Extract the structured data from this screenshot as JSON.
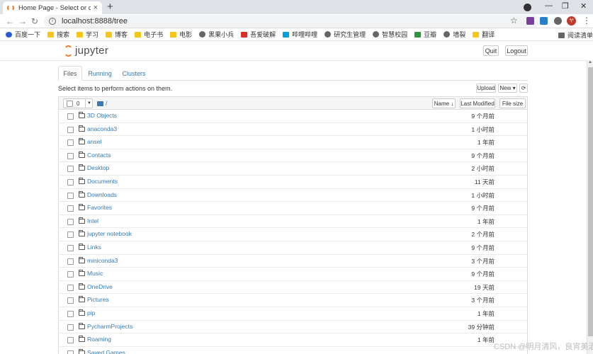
{
  "browser": {
    "tab_title": "Home Page - Select or create",
    "tab_close": "×",
    "new_tab": "+",
    "url": "localhost:8888/tree",
    "avatar_letter": "ヤ",
    "bookmarks": [
      {
        "label": "百度一下",
        "icon": "paw-icon"
      },
      {
        "label": "搜索",
        "icon": "folder-icon"
      },
      {
        "label": "学习",
        "icon": "folder-icon"
      },
      {
        "label": "博客",
        "icon": "folder-icon"
      },
      {
        "label": "电子书",
        "icon": "folder-icon"
      },
      {
        "label": "电影",
        "icon": "folder-icon"
      },
      {
        "label": "黑果小兵",
        "icon": "globe-icon"
      },
      {
        "label": "吾爱破解",
        "icon": "red-icon"
      },
      {
        "label": "哔哩哔哩",
        "icon": "tv-icon"
      },
      {
        "label": "研究生管理",
        "icon": "globe-icon"
      },
      {
        "label": "智慧校园",
        "icon": "globe-icon"
      },
      {
        "label": "豆瓣",
        "icon": "green-icon"
      },
      {
        "label": "墙裂",
        "icon": "globe-icon"
      },
      {
        "label": "翻译",
        "icon": "folder-icon"
      }
    ],
    "reading_list": "阅读清单"
  },
  "jupyter": {
    "logo_text": "jupyter",
    "quit_label": "Quit",
    "logout_label": "Logout",
    "tabs": [
      {
        "label": "Files",
        "active": true
      },
      {
        "label": "Running",
        "active": false
      },
      {
        "label": "Clusters",
        "active": false
      }
    ],
    "hint": "Select items to perform actions on them.",
    "upload_label": "Upload",
    "new_label": "New ▾",
    "refresh_label": "⟳",
    "selected_count": "0",
    "breadcrumb": "/",
    "name_sort_label": "Name ↓",
    "last_modified_label": "Last Modified",
    "file_size_label": "File size",
    "files": [
      {
        "name": "3D Objects",
        "modified": "9 个月前"
      },
      {
        "name": "anaconda3",
        "modified": "1 小时前"
      },
      {
        "name": "ansel",
        "modified": "1 年前"
      },
      {
        "name": "Contacts",
        "modified": "9 个月前"
      },
      {
        "name": "Desktop",
        "modified": "2 小时前"
      },
      {
        "name": "Documents",
        "modified": "11 天前"
      },
      {
        "name": "Downloads",
        "modified": "1 小时前"
      },
      {
        "name": "Favorites",
        "modified": "9 个月前"
      },
      {
        "name": "Intel",
        "modified": "1 年前"
      },
      {
        "name": "jupyter notebook",
        "modified": "2 个月前"
      },
      {
        "name": "Links",
        "modified": "9 个月前"
      },
      {
        "name": "miniconda3",
        "modified": "3 个月前"
      },
      {
        "name": "Music",
        "modified": "9 个月前"
      },
      {
        "name": "OneDrive",
        "modified": "19 天前"
      },
      {
        "name": "Pictures",
        "modified": "3 个月前"
      },
      {
        "name": "pip",
        "modified": "1 年前"
      },
      {
        "name": "PycharmProjects",
        "modified": "39 分钟前"
      },
      {
        "name": "Roaming",
        "modified": "1 年前"
      },
      {
        "name": "Saved Games",
        "modified": ""
      }
    ]
  },
  "watermark": "CSDN @明月清风，良宵美酒"
}
